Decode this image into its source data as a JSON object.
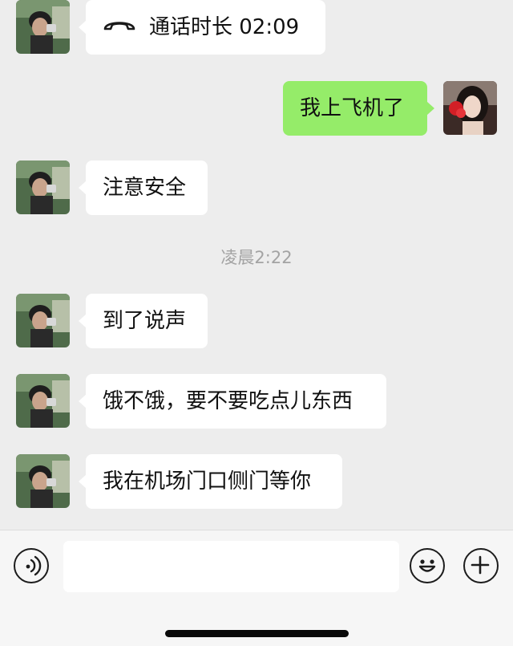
{
  "conversation": {
    "call_message": {
      "icon": "phone-hangup-icon",
      "text": "通话时长 02:09"
    },
    "sent_message": {
      "text": "我上飞机了"
    },
    "message_safety": {
      "text": "注意安全"
    },
    "timestamp": "凌晨2:22",
    "message_arrived": {
      "text": "到了说声"
    },
    "message_hungry": {
      "text": "饿不饿，要不要吃点儿东西"
    },
    "message_waiting": {
      "text": "我在机场门口侧门等你"
    }
  },
  "input_bar": {
    "voice_icon": "voice-icon",
    "text_value": "",
    "emoji_icon": "emoji-icon",
    "plus_icon": "plus-icon"
  },
  "colors": {
    "chat_background": "#ededed",
    "sent_bubble": "#95ec69",
    "received_bubble": "#ffffff",
    "timestamp_text": "#a3a3a3"
  }
}
